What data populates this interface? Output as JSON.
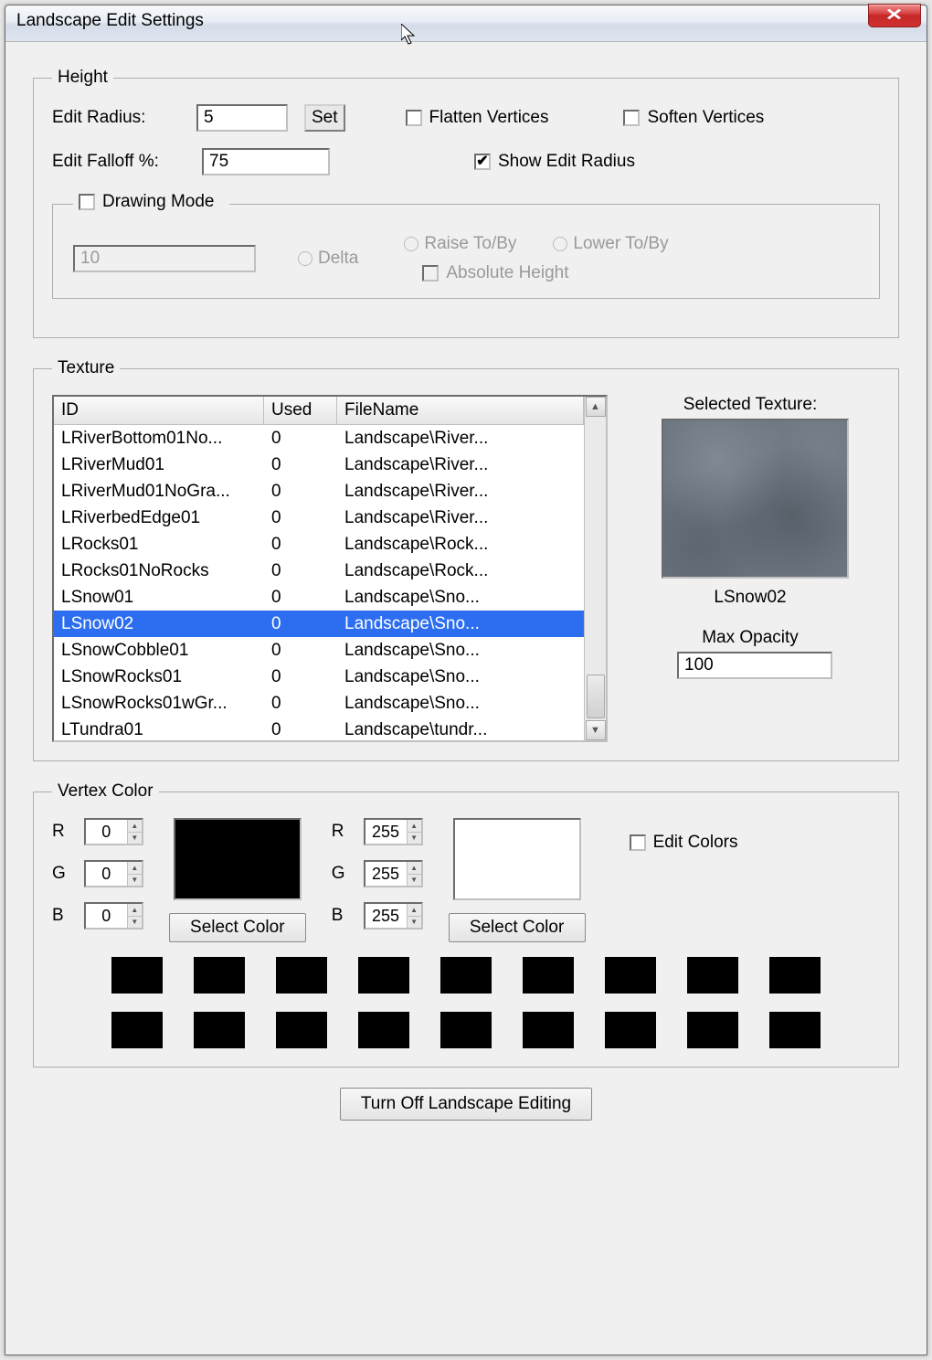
{
  "window": {
    "title": "Landscape Edit Settings"
  },
  "height": {
    "legend": "Height",
    "edit_radius_label": "Edit Radius:",
    "edit_radius_value": "5",
    "set_btn": "Set",
    "flatten_label": "Flatten Vertices",
    "flatten_checked": false,
    "soften_label": "Soften Vertices",
    "soften_checked": false,
    "falloff_label": "Edit Falloff %:",
    "falloff_value": "75",
    "show_radius_label": "Show Edit Radius",
    "show_radius_checked": true,
    "drawing": {
      "legend": "Drawing Mode",
      "checked": false,
      "value": "10",
      "delta_label": "Delta",
      "raise_label": "Raise To/By",
      "lower_label": "Lower To/By",
      "absolute_label": "Absolute Height"
    }
  },
  "texture": {
    "legend": "Texture",
    "columns": {
      "id": "ID",
      "used": "Used",
      "filename": "FileName"
    },
    "rows": [
      {
        "id": "LRiverBottom01No...",
        "used": "0",
        "fn": "Landscape\\River..."
      },
      {
        "id": "LRiverMud01",
        "used": "0",
        "fn": "Landscape\\River..."
      },
      {
        "id": "LRiverMud01NoGra...",
        "used": "0",
        "fn": "Landscape\\River..."
      },
      {
        "id": "LRiverbedEdge01",
        "used": "0",
        "fn": "Landscape\\River..."
      },
      {
        "id": "LRocks01",
        "used": "0",
        "fn": "Landscape\\Rock..."
      },
      {
        "id": "LRocks01NoRocks",
        "used": "0",
        "fn": "Landscape\\Rock..."
      },
      {
        "id": "LSnow01",
        "used": "0",
        "fn": "Landscape\\Sno..."
      },
      {
        "id": "LSnow02",
        "used": "0",
        "fn": "Landscape\\Sno...",
        "selected": true
      },
      {
        "id": "LSnowCobble01",
        "used": "0",
        "fn": "Landscape\\Sno..."
      },
      {
        "id": "LSnowRocks01",
        "used": "0",
        "fn": "Landscape\\Sno..."
      },
      {
        "id": "LSnowRocks01wGr...",
        "used": "0",
        "fn": "Landscape\\Sno..."
      },
      {
        "id": "LTundra01",
        "used": "0",
        "fn": "Landscape\\tundr..."
      }
    ],
    "selected_label": "Selected Texture:",
    "selected_name": "LSnow02",
    "max_opacity_label": "Max Opacity",
    "max_opacity_value": "100"
  },
  "vertex_color": {
    "legend": "Vertex Color",
    "r_label": "R",
    "g_label": "G",
    "b_label": "B",
    "left": {
      "r": "0",
      "g": "0",
      "b": "0"
    },
    "right": {
      "r": "255",
      "g": "255",
      "b": "255"
    },
    "select_color_btn": "Select Color",
    "edit_colors_label": "Edit Colors",
    "edit_colors_checked": false
  },
  "bottom_button": "Turn Off Landscape Editing"
}
